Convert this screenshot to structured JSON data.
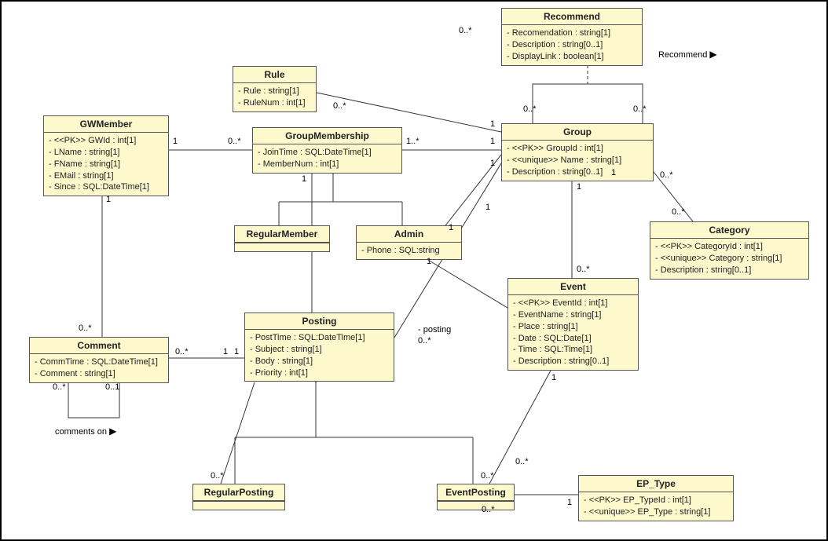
{
  "classes": {
    "gwmember": {
      "name": "GWMember",
      "attrs": [
        "- <<PK>> GWId : int[1]",
        "- LName : string[1]",
        "- FName : string[1]",
        "- EMail : string[1]",
        "- Since : SQL:DateTime[1]"
      ]
    },
    "rule": {
      "name": "Rule",
      "attrs": [
        "- Rule : string[1]",
        "- RuleNum : int[1]"
      ]
    },
    "groupmembership": {
      "name": "GroupMembership",
      "attrs": [
        "- JoinTime : SQL:DateTime[1]",
        "- MemberNum : int[1]"
      ]
    },
    "recommend": {
      "name": "Recommend",
      "attrs": [
        "- Recomendation : string[1]",
        "- Description : string[0..1]",
        "- DisplayLink : boolean[1]"
      ]
    },
    "group": {
      "name": "Group",
      "attrs": [
        "- <<PK>> GroupId : int[1]",
        "- <<unique>> Name : string[1]",
        "- Description : string[0..1]"
      ]
    },
    "regularmember": {
      "name": "RegularMember",
      "attrs": []
    },
    "admin": {
      "name": "Admin",
      "attrs": [
        "- Phone : SQL:string"
      ]
    },
    "category": {
      "name": "Category",
      "attrs": [
        "- <<PK>> CategoryId : int[1]",
        "- <<unique>> Category : string[1]",
        "- Description : string[0..1]"
      ]
    },
    "comment": {
      "name": "Comment",
      "attrs": [
        "- CommTime : SQL:DateTime[1]",
        "- Comment : string[1]"
      ]
    },
    "posting": {
      "name": "Posting",
      "attrs": [
        "- PostTime : SQL:DateTime[1]",
        "- Subject : string[1]",
        "- Body : string[1]",
        "- Priority : int[1]"
      ]
    },
    "event": {
      "name": "Event",
      "attrs": [
        "- <<PK>> EventId : int[1]",
        "- EventName : string[1]",
        "- Place : string[1]",
        "- Date : SQL:Date[1]",
        "- Time : SQL:Time[1]",
        "- Description : string[0..1]"
      ]
    },
    "regularposting": {
      "name": "RegularPosting",
      "attrs": []
    },
    "eventposting": {
      "name": "EventPosting",
      "attrs": []
    },
    "ep_type": {
      "name": "EP_Type",
      "attrs": [
        "- <<PK>> EP_TypeId : int[1]",
        "- <<unique>> EP_Type : string[1]"
      ]
    }
  },
  "labels": {
    "recommend_assoc": "Recommend",
    "posting_role": "- posting",
    "comments_on": "comments on"
  },
  "mults": {
    "m1": "1",
    "m0star": "0..*",
    "m1star": "1..*",
    "m01": "0..1"
  }
}
